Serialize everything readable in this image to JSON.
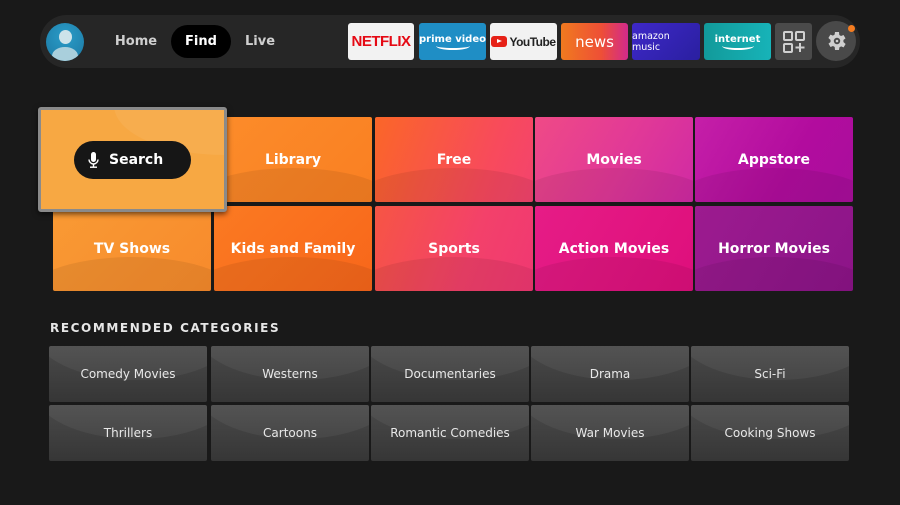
{
  "topbar": {
    "avatar": "profile-avatar",
    "nav": [
      {
        "label": "Home",
        "active": false
      },
      {
        "label": "Find",
        "active": true
      },
      {
        "label": "Live",
        "active": false
      }
    ],
    "apps": [
      {
        "name": "netflix",
        "label": "NETFLIX"
      },
      {
        "name": "prime-video",
        "label": "prime video"
      },
      {
        "name": "youtube",
        "label": "YouTube"
      },
      {
        "name": "news",
        "label": "news"
      },
      {
        "name": "amazon-music",
        "label": "amazon music"
      },
      {
        "name": "internet",
        "label": "internet"
      }
    ],
    "apps_icon": "apps-grid-icon",
    "settings_icon": "gear-icon",
    "notification_color": "#f47c20"
  },
  "find": {
    "search": {
      "label": "Search",
      "icon": "microphone-icon"
    },
    "tiles": [
      {
        "label": "Library",
        "color": "#fb8a28"
      },
      {
        "label": "Free",
        "color": "#f85a4a"
      },
      {
        "label": "Movies",
        "color": "#e93f8c"
      },
      {
        "label": "Appstore",
        "color": "#b514a4"
      },
      {
        "label": "TV Shows",
        "color": "#f89530"
      },
      {
        "label": "Kids and Family",
        "color": "#f97020"
      },
      {
        "label": "Sports",
        "color": "#f24d5c"
      },
      {
        "label": "Action Movies",
        "color": "#e11b7d"
      },
      {
        "label": "Horror Movies",
        "color": "#93178a"
      }
    ]
  },
  "recommended": {
    "title": "RECOMMENDED CATEGORIES",
    "items": [
      "Comedy Movies",
      "Westerns",
      "Documentaries",
      "Drama",
      "Sci-Fi",
      "Thrillers",
      "Cartoons",
      "Romantic Comedies",
      "War Movies",
      "Cooking Shows"
    ]
  }
}
